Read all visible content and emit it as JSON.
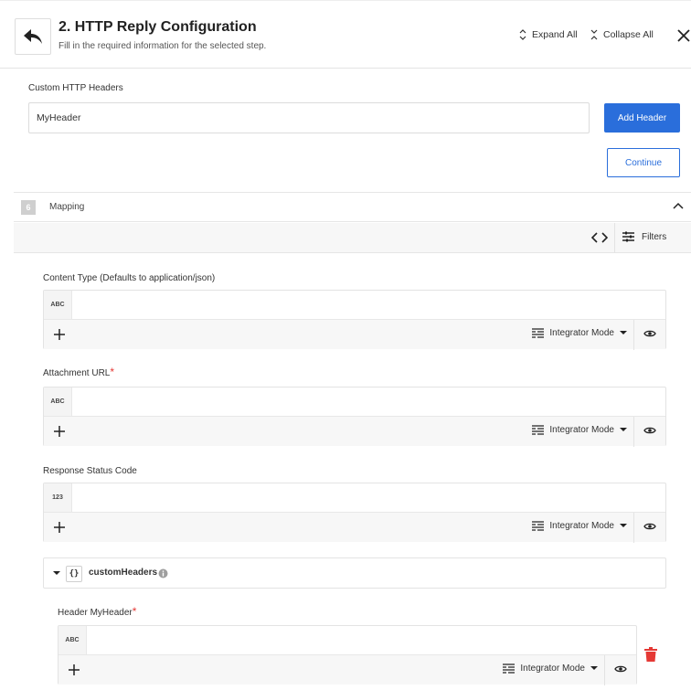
{
  "header": {
    "title": "2. HTTP Reply Configuration",
    "subtitle": "Fill in the required information for the selected step.",
    "expand_all": "Expand All",
    "collapse_all": "Collapse All"
  },
  "custom_headers": {
    "label": "Custom HTTP Headers",
    "input_value": "MyHeader",
    "add_button": "Add Header",
    "continue_button": "Continue"
  },
  "mapping": {
    "step_number": "6",
    "label": "Mapping",
    "filters_label": "Filters"
  },
  "fields": [
    {
      "label": "Content Type (Defaults to application/json)",
      "required": "",
      "type_badge": "ABC",
      "value": "",
      "mode": "Integrator Mode"
    },
    {
      "label": "Attachment URL",
      "required": "*",
      "type_badge": "ABC",
      "value": "",
      "mode": "Integrator Mode"
    },
    {
      "label": "Response Status Code",
      "required": "",
      "type_badge": "123",
      "value": "",
      "mode": "Integrator Mode"
    }
  ],
  "custom_headers_object": {
    "icon_text": "{}",
    "label": "customHeaders"
  },
  "header_field": {
    "label": "Header MyHeader",
    "required": "*",
    "type_badge": "ABC",
    "value": "",
    "mode": "Integrator Mode"
  },
  "colors": {
    "primary": "#2a6edb",
    "required": "#e53935",
    "delete": "#e53935"
  }
}
